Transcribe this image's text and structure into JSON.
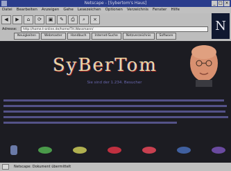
{
  "window": {
    "title": "Netscape - [Sybertom's Haus]"
  },
  "menu": [
    "Datei",
    "Bearbeiten",
    "Anzeigen",
    "Gehe",
    "Lesezeichen",
    "Optionen",
    "Verzeichnis",
    "Fenster",
    "Hilfe"
  ],
  "toolbar": [
    "◀",
    "▶",
    "⌂",
    "⟳",
    "▣",
    "✎",
    "⎙",
    "⌕",
    "⨯"
  ],
  "address": {
    "label": "Adresse:",
    "value": "http://home.t-online.de/home/TH.Wassmann/"
  },
  "navbuttons": [
    "Neuigkeiten",
    "Webmaster",
    "Handbuch",
    "Internet-Suche",
    "Netzverzeichnis",
    "Software"
  ],
  "page": {
    "logo": "SyBerTom",
    "subtitle": "Sie sind der 1.234. Besucher"
  },
  "status": {
    "text": "Netscape: Dokument übermittelt"
  },
  "colors": {
    "logo_primary": "#e8d8a0",
    "para_text": "#7a78b8",
    "page_bg": "#1c1c22"
  }
}
